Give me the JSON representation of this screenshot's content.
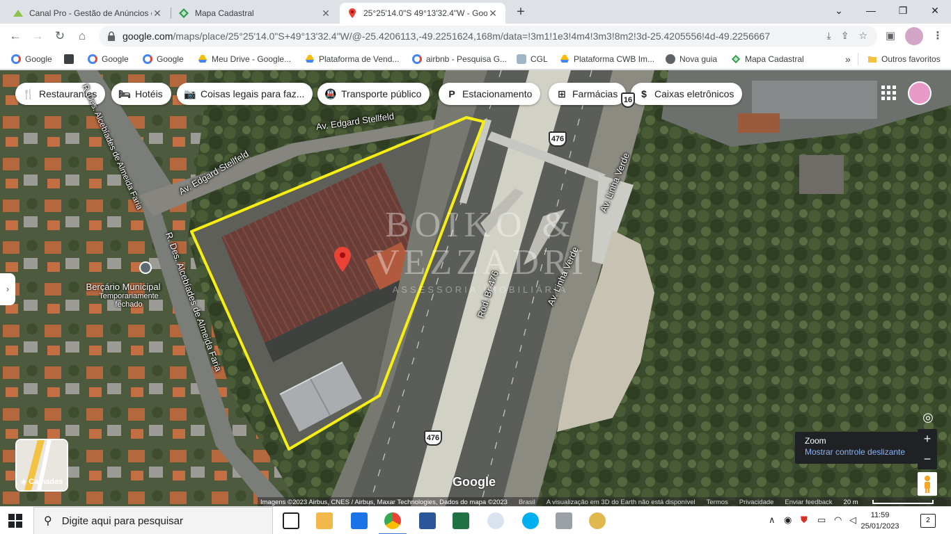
{
  "browser": {
    "tabs": [
      {
        "title": "Canal Pro - Gestão de Anúncios e",
        "icon": "zap-imoveis-icon",
        "active": false
      },
      {
        "title": "Mapa Cadastral",
        "icon": "mapa-cadastral-icon",
        "active": false
      },
      {
        "title": "25°25'14.0\"S 49°13'32.4\"W - Goo",
        "icon": "google-maps-pin-icon",
        "active": true
      }
    ],
    "new_tab_label": "+",
    "window_controls": {
      "collapse": "⌄",
      "minimize": "—",
      "restore": "❐",
      "close": "✕"
    },
    "url_host": "google.com",
    "url_path": "/maps/place/25°25'14.0\"S+49°13'32.4\"W/@-25.4206113,-49.2251624,168m/data=!3m1!1e3!4m4!3m3!8m2!3d-25.4205556!4d-49.2256667"
  },
  "bookmarks": [
    {
      "label": "Google",
      "icon": "google-g-icon"
    },
    {
      "label": "",
      "icon": "img-tfy-icon"
    },
    {
      "label": "Google",
      "icon": "google-g-icon"
    },
    {
      "label": "Google",
      "icon": "google-g-icon"
    },
    {
      "label": "Meu Drive - Google...",
      "icon": "google-drive-icon"
    },
    {
      "label": "Plataforma de Vend...",
      "icon": "google-drive-icon"
    },
    {
      "label": "airbnb - Pesquisa G...",
      "icon": "google-g-icon"
    },
    {
      "label": "CGL",
      "icon": "cgl-icon"
    },
    {
      "label": "Plataforma CWB Im...",
      "icon": "google-drive-icon"
    },
    {
      "label": "Nova guia",
      "icon": "globe-icon"
    },
    {
      "label": "Mapa Cadastral",
      "icon": "mapa-cadastral-icon"
    }
  ],
  "bookmarks_more": "»",
  "bookmarks_other": "Outros favoritos",
  "map": {
    "chips": [
      {
        "label": "Restaurantes",
        "icon": "restaurant-icon",
        "glyph": "🍴"
      },
      {
        "label": "Hotéis",
        "icon": "hotel-icon",
        "glyph": "🛏"
      },
      {
        "label": "Coisas legais para faz...",
        "icon": "camera-icon",
        "glyph": "📷"
      },
      {
        "label": "Transporte público",
        "icon": "transit-icon",
        "glyph": "🚇"
      },
      {
        "label": "Estacionamento",
        "icon": "parking-icon",
        "glyph": "P"
      },
      {
        "label": "Farmácias",
        "icon": "pharmacy-icon",
        "glyph": "⊞"
      },
      {
        "label": "Caixas eletrônicos",
        "icon": "atm-icon",
        "glyph": "$"
      }
    ],
    "street_labels": {
      "edgard_1": "Av. Edgard Stellfeld",
      "edgard_2": "Av. Edgard Stellfeld",
      "alcebiades_top": "R. Des. Alcebíades de Almeida Faria",
      "alcebiades_side": "R. Des. Alcebíades de Almeida Faria",
      "linha_verde_1": "Av. Linha Verde",
      "linha_verde_2": "Av. Linha Verde",
      "rod_br": "Rod. Br-476"
    },
    "poi": {
      "name": "Berçário Municipal",
      "status": "Temporariamente fechado"
    },
    "route_shields": [
      "476",
      "476",
      "16"
    ],
    "watermark": {
      "line1": "BOIKO &",
      "line2": "VEZZADRI",
      "line3": "ASSESSORIA IMOBILIÁRIA"
    },
    "layers_label": "Camadas",
    "zoom_tooltip": {
      "title": "Zoom",
      "link": "Mostrar controle deslizante"
    },
    "zoom_in": "+",
    "zoom_out": "−",
    "google_logo": "Google",
    "attribution": {
      "imagery": "Imagens ©2023 Airbus, CNES / Airbus, Maxar Technologies, Dados do mapa ©2023",
      "country": "Brasil",
      "earth_notice": "A visualização em 3D do Earth não está disponível",
      "terms": "Termos",
      "privacy": "Privacidade",
      "feedback": "Enviar feedback",
      "scale": "20 m"
    },
    "colors": {
      "outline": "#f7ee14",
      "pin": "#ea4335"
    }
  },
  "taskbar": {
    "search_placeholder": "Digite aqui para pesquisar",
    "time": "11:59",
    "date": "25/01/2023",
    "notifications": "2"
  }
}
